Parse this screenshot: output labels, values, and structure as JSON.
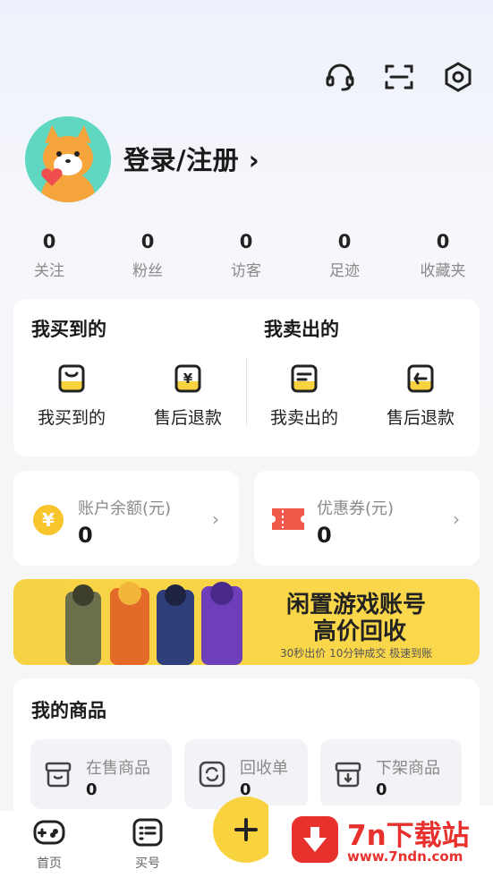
{
  "header": {
    "icons": [
      "headset-icon",
      "scan-icon",
      "settings-icon"
    ]
  },
  "profile": {
    "login_label": "登录/注册 ›"
  },
  "stats": [
    {
      "value": "0",
      "label": "关注"
    },
    {
      "value": "0",
      "label": "粉丝"
    },
    {
      "value": "0",
      "label": "访客"
    },
    {
      "value": "0",
      "label": "足迹"
    },
    {
      "value": "0",
      "label": "收藏夹"
    }
  ],
  "orders": {
    "bought_title": "我买到的",
    "sold_title": "我卖出的",
    "items": [
      {
        "label": "我买到的",
        "icon": "bag-icon"
      },
      {
        "label": "售后退款",
        "icon": "yuan-refund-icon"
      },
      {
        "label": "我卖出的",
        "icon": "list-icon"
      },
      {
        "label": "售后退款",
        "icon": "return-icon"
      }
    ]
  },
  "wallet": {
    "balance_title": "账户余额(元)",
    "balance_value": "0",
    "coupon_title": "优惠券(元)",
    "coupon_value": "0"
  },
  "banner": {
    "line1": "闲置游戏账号",
    "line2": "高价回收",
    "sub": "30秒出价 10分钟成交 极速到账"
  },
  "goods": {
    "title": "我的商品",
    "items": [
      {
        "label": "在售商品",
        "value": "0"
      },
      {
        "label": "回收单",
        "value": "0"
      },
      {
        "label": "下架商品",
        "value": "0"
      }
    ]
  },
  "tabbar": {
    "home": "首页",
    "buy": "买号"
  },
  "watermark": {
    "name": "7n下载站",
    "url": "www.7ndn.com"
  },
  "colors": {
    "accent_yellow": "#f8d33f",
    "teal": "#5fd7c1",
    "coupon_red": "#f15a4a",
    "watermark_red": "#e8302c"
  }
}
